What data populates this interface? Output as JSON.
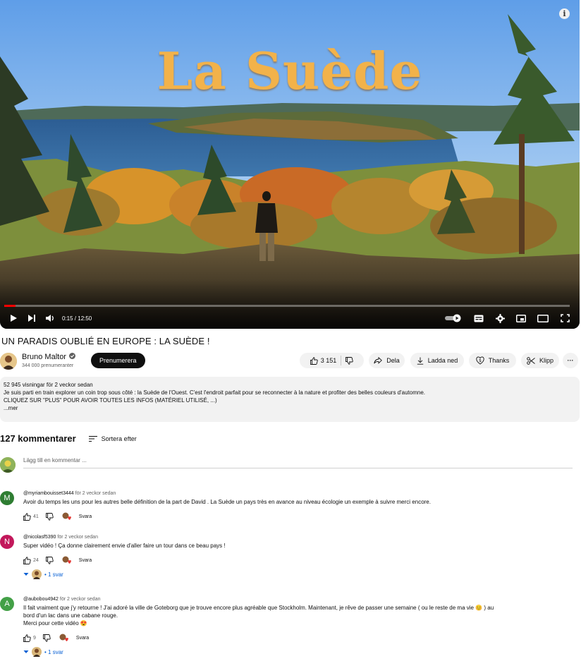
{
  "player": {
    "overlay_title": "La Suède",
    "time": "0:15 / 12:50",
    "progress_fraction": 0.02,
    "info_glyph": "i",
    "icons": [
      "play-icon",
      "next-icon",
      "volume-icon",
      "autoplay-toggle",
      "subtitles-icon",
      "settings-icon",
      "miniplayer-icon",
      "theater-icon",
      "fullscreen-icon"
    ]
  },
  "video": {
    "title": "UN PARADIS OUBLIÉ EN EUROPE : LA SUÈDE !",
    "channel": "Bruno Maltor",
    "subscribers": "344 000 prenumeranter",
    "subscribe_label": "Prenumerera",
    "likes": "3 151",
    "share_label": "Dela",
    "download_label": "Ladda ned",
    "thanks_label": "Thanks",
    "clip_label": "Klipp",
    "more_glyph": "···"
  },
  "description": {
    "meta": "52 945 visningar  för 2 veckor sedan",
    "line1": "Je suis parti en train explorer un coin trop sous côté : la Suède de l'Ouest. C'est l'endroit parfait pour se reconnecter à la nature et profiter des belles couleurs d'automne.",
    "line2": "CLIQUEZ SUR \"PLUS\" POUR AVOIR TOUTES LES INFOS (MATÉRIEL UTILISÉ, ...)",
    "more": "...mer"
  },
  "comments_section": {
    "count": "127 kommentarer",
    "sort_label": "Sortera efter",
    "add_placeholder": "Lägg till en kommentar ...",
    "items": [
      {
        "initial": "M",
        "avatar_color": "#2e7d32",
        "author": "@myriambouisset3444",
        "time": "för 2 veckor sedan",
        "text": "Avoir du temps les uns pour les autres belle définition de la part de David . La Suède un pays très en avance au niveau écologie un exemple à suivre merci encore.",
        "likes": "41",
        "reply_label": "Svara"
      },
      {
        "initial": "N",
        "avatar_color": "#c2185b",
        "author": "@nicolasf5390",
        "time": "för 2 veckor sedan",
        "text": "Super vidéo ! Ça donne clairement envie d'aller faire un tour dans ce beau pays !",
        "likes": "24",
        "reply_label": "Svara",
        "replies": "• 1 svar"
      },
      {
        "initial": "A",
        "avatar_color": "#43a047",
        "author": "@aubobou4942",
        "time": "för 2 veckor sedan",
        "text1": "Il fait vraiment que j'y retourne  ! J'ai adoré la ville de Goteborg que je trouve encore plus agréable que Stockholm. Maintenant, je rêve de passer une semaine ( ou le reste de ma vie 😊 )  au",
        "text2": "bord d'un lac dans une cabane rouge.",
        "text3": "Merci pour cette vidéo 😍",
        "likes": "9",
        "reply_label": "Svara",
        "replies": "• 1 svar"
      }
    ]
  }
}
